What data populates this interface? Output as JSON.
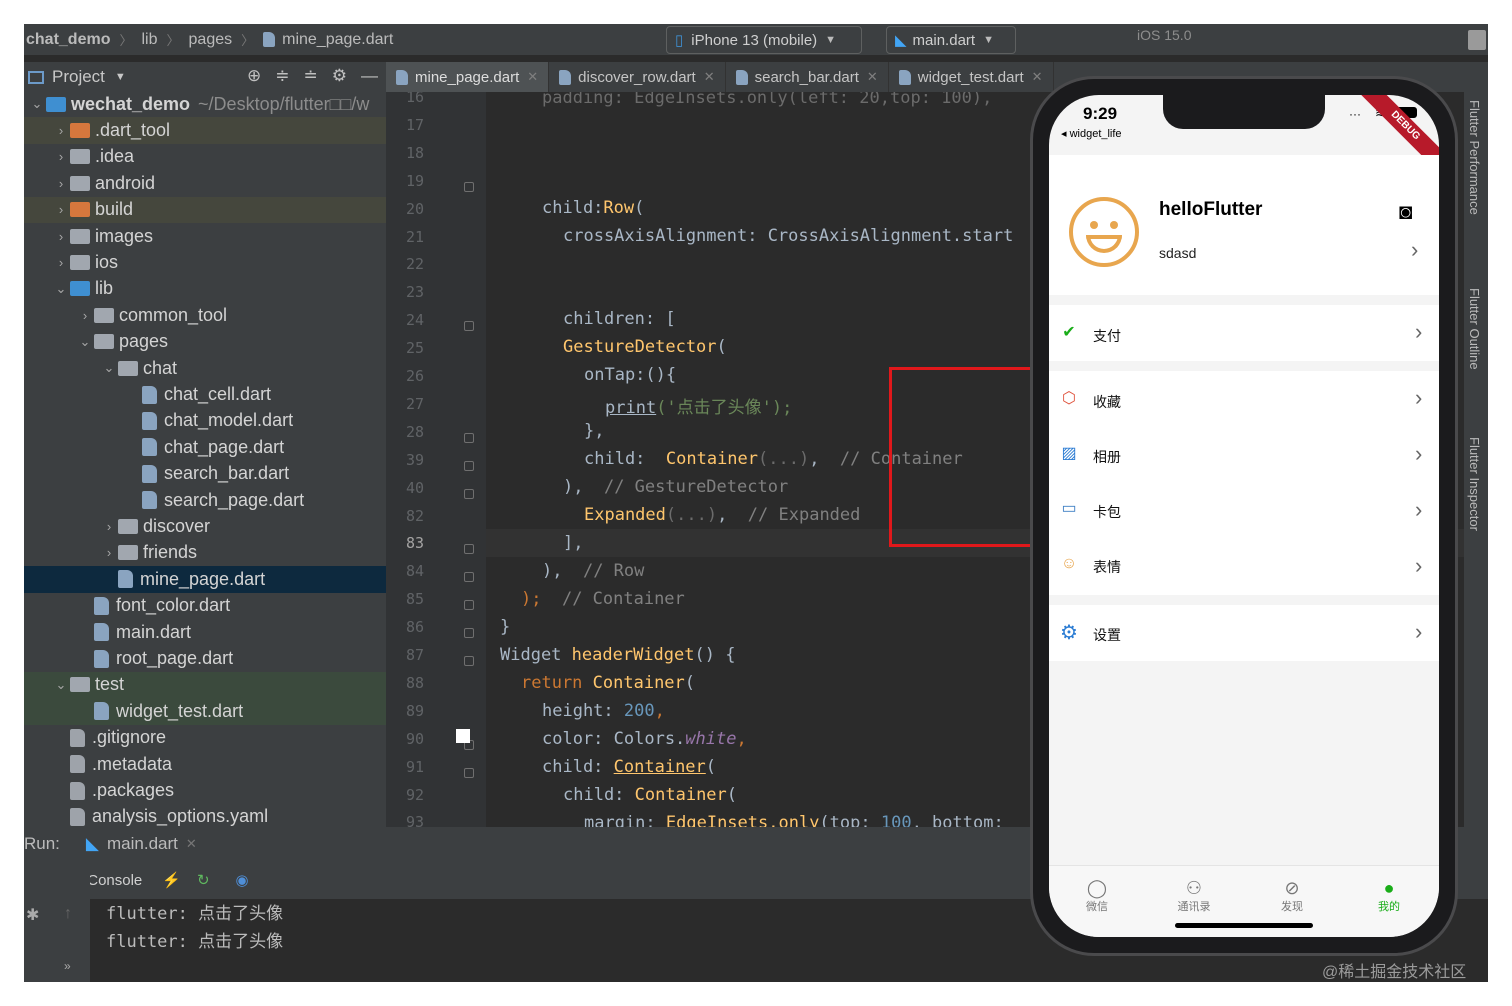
{
  "breadcrumb": {
    "project": "chat_demo",
    "seg1": "lib",
    "seg2": "pages",
    "file": "mine_page.dart"
  },
  "toolbar": {
    "device": "iPhone 13 (mobile)",
    "run_config": "main.dart",
    "ios_version": "iOS 15.0"
  },
  "project_panel": {
    "title": "Project"
  },
  "tree": [
    {
      "label": "wechat_demo",
      "extra": "~/Desktop/flutter□□/w",
      "level": 0,
      "arrow": "v",
      "type": "root"
    },
    {
      "label": ".dart_tool",
      "level": 1,
      "arrow": ">",
      "type": "folder-orange",
      "hl": true
    },
    {
      "label": ".idea",
      "level": 1,
      "arrow": ">",
      "type": "folder"
    },
    {
      "label": "android",
      "level": 1,
      "arrow": ">",
      "type": "folder"
    },
    {
      "label": "build",
      "level": 1,
      "arrow": ">",
      "type": "folder-orange",
      "hl": true
    },
    {
      "label": "images",
      "level": 1,
      "arrow": ">",
      "type": "folder"
    },
    {
      "label": "ios",
      "level": 1,
      "arrow": ">",
      "type": "folder"
    },
    {
      "label": "lib",
      "level": 1,
      "arrow": "v",
      "type": "folder-blue"
    },
    {
      "label": "common_tool",
      "level": 2,
      "arrow": ">",
      "type": "folder"
    },
    {
      "label": "pages",
      "level": 2,
      "arrow": "v",
      "type": "folder"
    },
    {
      "label": "chat",
      "level": 3,
      "arrow": "v",
      "type": "folder"
    },
    {
      "label": "chat_cell.dart",
      "level": 4,
      "arrow": "",
      "type": "dart"
    },
    {
      "label": "chat_model.dart",
      "level": 4,
      "arrow": "",
      "type": "dart"
    },
    {
      "label": "chat_page.dart",
      "level": 4,
      "arrow": "",
      "type": "dart"
    },
    {
      "label": "search_bar.dart",
      "level": 4,
      "arrow": "",
      "type": "dart"
    },
    {
      "label": "search_page.dart",
      "level": 4,
      "arrow": "",
      "type": "dart"
    },
    {
      "label": "discover",
      "level": 3,
      "arrow": ">",
      "type": "folder"
    },
    {
      "label": "friends",
      "level": 3,
      "arrow": ">",
      "type": "folder"
    },
    {
      "label": "mine_page.dart",
      "level": 3,
      "arrow": "",
      "type": "dart",
      "sel": true
    },
    {
      "label": "font_color.dart",
      "level": 2,
      "arrow": "",
      "type": "dart"
    },
    {
      "label": "main.dart",
      "level": 2,
      "arrow": "",
      "type": "dart"
    },
    {
      "label": "root_page.dart",
      "level": 2,
      "arrow": "",
      "type": "dart"
    },
    {
      "label": "test",
      "level": 1,
      "arrow": "v",
      "type": "folder",
      "grn": true
    },
    {
      "label": "widget_test.dart",
      "level": 2,
      "arrow": "",
      "type": "dart",
      "grn": true
    },
    {
      "label": ".gitignore",
      "level": 1,
      "arrow": "",
      "type": "file"
    },
    {
      "label": ".metadata",
      "level": 1,
      "arrow": "",
      "type": "file"
    },
    {
      "label": ".packages",
      "level": 1,
      "arrow": "",
      "type": "file"
    },
    {
      "label": "analysis_options.yaml",
      "level": 1,
      "arrow": "",
      "type": "yaml"
    }
  ],
  "tabs": [
    {
      "label": "mine_page.dart",
      "active": true
    },
    {
      "label": "discover_row.dart"
    },
    {
      "label": "search_bar.dart"
    },
    {
      "label": "widget_test.dart"
    }
  ],
  "line_numbers": [
    "16",
    "17",
    "18",
    "19",
    "20",
    "21",
    "22",
    "23",
    "24",
    "25",
    "26",
    "27",
    "28",
    "39",
    "40",
    "82",
    "83",
    "84",
    "85",
    "86",
    "87",
    "88",
    "89",
    "90",
    "91",
    "92",
    "93"
  ],
  "code": {
    "l16": "padding: EdgeInsets.only(left: 20,top: 100),",
    "l19a": "child:",
    "l19b": "Row",
    "l19c": "(",
    "l20": "crossAxisAlignment: CrossAxisAlignment.start",
    "l23": "children: [",
    "l24a": "GestureDetector",
    "l24b": "(",
    "l25": "onTap:(){",
    "l26a": "print",
    "l26b": "('",
    "l26c": "点击了头像",
    "l26d": "');",
    "l27": "},",
    "l28a": "child:  ",
    "l28b": "Container",
    "l28c": "(...)",
    "l28d": ",  ",
    "l28e": "// Container",
    "l39a": "), ",
    "l39b": " // GestureDetector",
    "l40a": "Expanded",
    "l40b": "(...)",
    "l40c": ",  ",
    "l40d": "// Expanded",
    "l82": "],",
    "l83a": "),  ",
    "l83b": "// Row",
    "l84a": ");  ",
    "l84b": "// Container",
    "l85": "}",
    "l86a": "Widget ",
    "l86b": "headerWidget",
    "l86c": "() {",
    "l87a": "return ",
    "l87b": "Container",
    "l87c": "(",
    "l88a": "height: ",
    "l88b": "200",
    "l89a": "color: Colors.",
    "l89b": "white",
    "l90a": "child: ",
    "l90b": "Container",
    "l90c": "(",
    "l91a": "child: ",
    "l91b": "Container",
    "l91c": "(",
    "l92a": "margin: ",
    "l92b": "EdgeInsets.only",
    "l92c": "(top: ",
    "l92d": "100",
    ", ": "",
    "l92e": "bottom:"
  },
  "run": {
    "label": "Run:",
    "config": "main.dart",
    "console_tab": "Console",
    "output": [
      "flutter: 点击了头像",
      "flutter: 点击了头像"
    ]
  },
  "right_strip": [
    "Flutter Performance",
    "Flutter Outline",
    "Flutter Inspector"
  ],
  "phone": {
    "time": "9:29",
    "back": "◂ widget_life",
    "debug": "DEBUG",
    "name": "helloFlutter",
    "sub": "sdasd",
    "cells": [
      {
        "label": "支付",
        "icon": "pay-icon"
      },
      {
        "label": "收藏",
        "icon": "favorite-icon"
      },
      {
        "label": "相册",
        "icon": "album-icon"
      },
      {
        "label": "卡包",
        "icon": "card-icon"
      },
      {
        "label": "表情",
        "icon": "emoji-icon"
      },
      {
        "label": "设置",
        "icon": "settings-icon"
      }
    ],
    "tabbar": [
      {
        "label": "微信"
      },
      {
        "label": "通讯录"
      },
      {
        "label": "发现"
      },
      {
        "label": "我的",
        "active": true
      }
    ],
    "colors": {
      "accent": "#1aad19",
      "avatar": "#e8a64e"
    }
  },
  "watermark": "@稀土掘金技术社区"
}
